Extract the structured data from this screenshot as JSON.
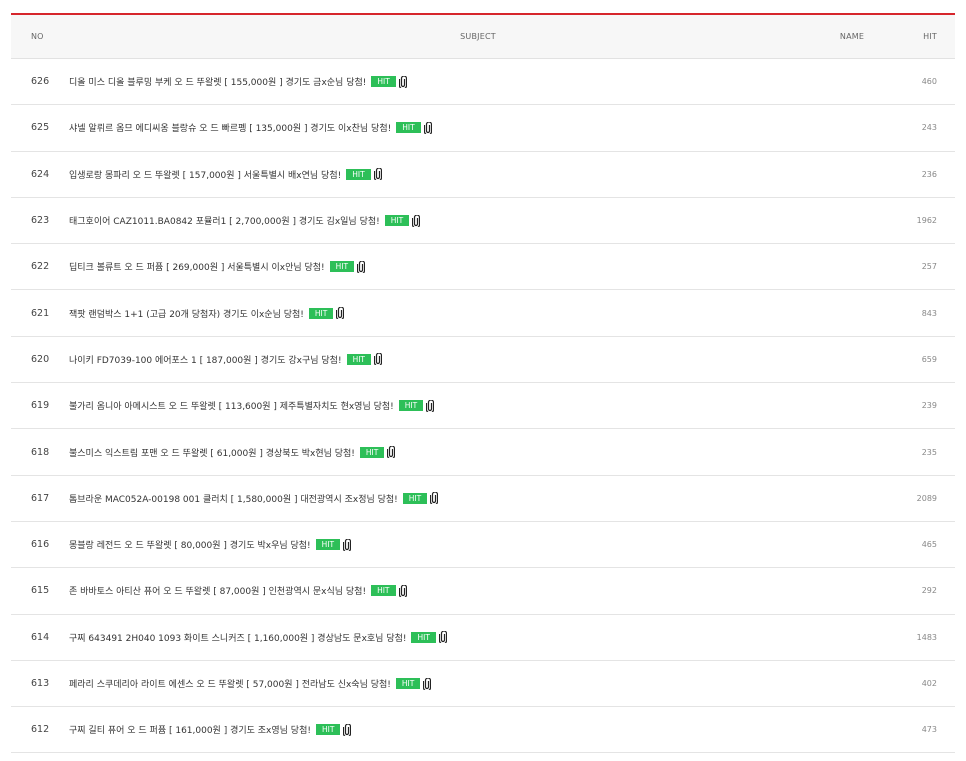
{
  "header": {
    "no": "NO",
    "subject": "SUBJECT",
    "name": "NAME",
    "hit": "HIT"
  },
  "hit_badge_color": "#2dbf58",
  "accent_color": "#d6262c",
  "rows": [
    {
      "no": "626",
      "subject": "디올 미스 디올 블루밍 부케 오 드 뚜왈렛 [ 155,000원 ] 경기도 금x순님 당첨!",
      "badge": "HIT",
      "name": "",
      "hit": "460"
    },
    {
      "no": "625",
      "subject": "샤넬 알뤼르 옴므 에디씨옹 블랑슈 오 드 빠르펭 [ 135,000원 ] 경기도 이x찬님 당첨!",
      "badge": "HIT",
      "name": "",
      "hit": "243"
    },
    {
      "no": "624",
      "subject": "입생로랑 몽파리 오 드 뚜왈렛 [ 157,000원 ] 서울특별시 배x연님 당첨!",
      "badge": "HIT",
      "name": "",
      "hit": "236"
    },
    {
      "no": "623",
      "subject": "태그호이어 CAZ1011.BA0842 포뮬러1 [ 2,700,000원 ] 경기도 김x일님 당첨!",
      "badge": "HIT",
      "name": "",
      "hit": "1962"
    },
    {
      "no": "622",
      "subject": "딥티크 볼류트 오 드 퍼퓸 [ 269,000원 ] 서울특별시 이x안님 당첨!",
      "badge": "HIT",
      "name": "",
      "hit": "257"
    },
    {
      "no": "621",
      "subject": "잭팟 랜덤박스 1+1 (고급 20개 당첨자) 경기도 이x순님 당첨!",
      "badge": "HIT",
      "name": "",
      "hit": "843"
    },
    {
      "no": "620",
      "subject": "나이키 FD7039-100 에어포스 1 [ 187,000원 ] 경기도 강x구님 당첨!",
      "badge": "HIT",
      "name": "",
      "hit": "659"
    },
    {
      "no": "619",
      "subject": "불가리 옴니아 아메시스트 오 드 뚜왈렛 [ 113,600원 ] 제주특별자치도 현x영님 당첨!",
      "badge": "HIT",
      "name": "",
      "hit": "239"
    },
    {
      "no": "618",
      "subject": "불스미스 익스트림 포맨 오 드 뚜왈렛 [ 61,000원 ] 경상북도 박x현님 당첨!",
      "badge": "HIT",
      "name": "",
      "hit": "235"
    },
    {
      "no": "617",
      "subject": "톰브라운 MAC052A-00198 001 클러치 [ 1,580,000원 ] 대전광역시 조x정님 당첨!",
      "badge": "HIT",
      "name": "",
      "hit": "2089"
    },
    {
      "no": "616",
      "subject": "몽블랑 레전드 오 드 뚜왈렛 [ 80,000원 ] 경기도 박x우님 당첨!",
      "badge": "HIT",
      "name": "",
      "hit": "465"
    },
    {
      "no": "615",
      "subject": "존 바바토스 아티산 퓨어 오 드 뚜왈렛 [ 87,000원 ] 인천광역시 문x식님 당첨!",
      "badge": "HIT",
      "name": "",
      "hit": "292"
    },
    {
      "no": "614",
      "subject": "구찌 643491 2H040 1093 화이트 스니커즈 [ 1,160,000원 ] 경상남도 문x호님 당첨!",
      "badge": "HIT",
      "name": "",
      "hit": "1483"
    },
    {
      "no": "613",
      "subject": "페라리 스쿠데리아 라이트 에센스 오 드 뚜왈렛 [ 57,000원 ] 전라남도 신x숙님 당첨!",
      "badge": "HIT",
      "name": "",
      "hit": "402"
    },
    {
      "no": "612",
      "subject": "구찌 길티 퓨어 오 드 퍼퓸 [ 161,000원 ] 경기도 조x영님 당첨!",
      "badge": "HIT",
      "name": "",
      "hit": "473"
    }
  ]
}
